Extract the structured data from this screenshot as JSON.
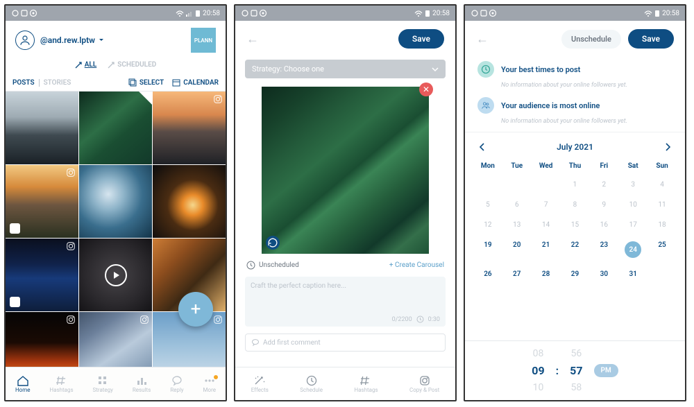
{
  "status_time": "20:58",
  "panel1": {
    "handle": "@and.rew.lptw",
    "logo": "PLANN",
    "tabs": {
      "all": "ALL",
      "scheduled": "SCHEDULED"
    },
    "sub": {
      "posts": "POSTS",
      "stories": "STORIES",
      "select": "SELECT",
      "calendar": "CALENDAR"
    },
    "nav": {
      "home": "Home",
      "hashtags": "Hashtags",
      "strategy": "Strategy",
      "results": "Results",
      "reply": "Reply",
      "more": "More"
    }
  },
  "panel2": {
    "save": "Save",
    "strategy": "Strategy: Choose one",
    "unscheduled": "Unscheduled",
    "create_carousel": "+ Create Carousel",
    "caption_ph": "Craft the perfect caption here...",
    "counter": "0/2200",
    "time": "0:30",
    "first_comment": "Add first comment",
    "nav": {
      "effects": "Effects",
      "schedule": "Schedule",
      "hashtags": "Hashtags",
      "copy": "Copy & Post"
    }
  },
  "panel3": {
    "unschedule": "Unschedule",
    "save": "Save",
    "best_times": "Your best times to post",
    "no_info": "No information about your online followers yet.",
    "audience": "Your audience is most online",
    "month": "July 2021",
    "days": [
      "Mon",
      "Tue",
      "Wed",
      "Thu",
      "Fri",
      "Sat",
      "Sun"
    ],
    "weeks": [
      [
        "",
        "",
        "",
        "1",
        "2",
        "3",
        "4"
      ],
      [
        "5",
        "6",
        "7",
        "8",
        "9",
        "10",
        "11"
      ],
      [
        "12",
        "13",
        "14",
        "15",
        "16",
        "17",
        "18"
      ],
      [
        "19",
        "20",
        "21",
        "22",
        "23",
        "24",
        "25"
      ],
      [
        "26",
        "27",
        "28",
        "29",
        "30",
        "31",
        ""
      ]
    ],
    "selected": "24",
    "time": {
      "h_prev": "08",
      "h": "09",
      "h_next": "10",
      "m_prev": "56",
      "m": "57",
      "m_next": "58",
      "ampm": "PM"
    }
  }
}
